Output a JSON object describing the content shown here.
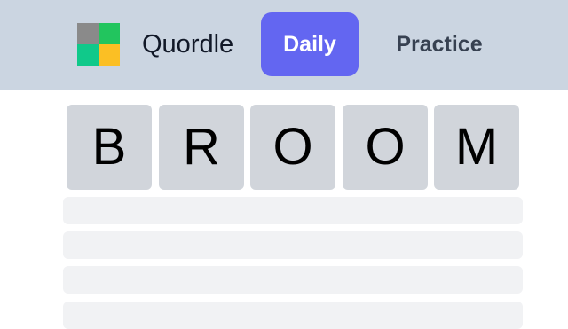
{
  "header": {
    "brand_name": "Quordle",
    "logo_colors": [
      "#8a8a8a",
      "#22c55e",
      "#10c98a",
      "#fbbf24"
    ],
    "tabs": [
      {
        "label": "Daily",
        "active": true,
        "bg": "#6366f1",
        "color": "#ffffff"
      },
      {
        "label": "Practice",
        "active": false,
        "bg": "transparent",
        "color": "#374151"
      }
    ]
  },
  "board": {
    "guess": [
      "B",
      "R",
      "O",
      "O",
      "M"
    ],
    "tile_color": "#d1d5db",
    "empty_row_color": "#f1f2f4",
    "empty_rows_visible": 4
  }
}
